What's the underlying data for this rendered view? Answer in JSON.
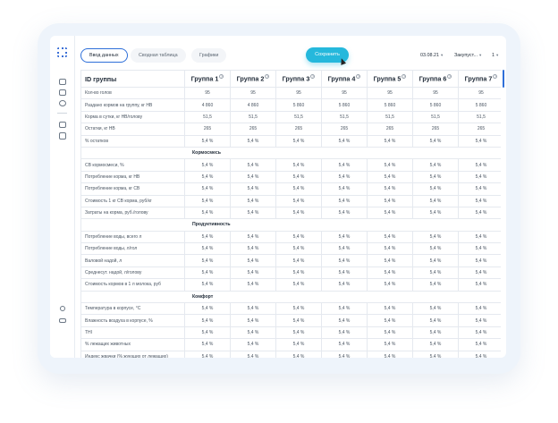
{
  "toolbar": {
    "tabs": [
      "Ввод данных",
      "Сводная таблица",
      "Графики"
    ],
    "save_label": "Сохранить",
    "date": "03.08.21",
    "filter": "Закупуст...",
    "page": "1"
  },
  "table": {
    "first_header": "ID группы",
    "groups": [
      "Группа 1",
      "Группа 2",
      "Группа 3",
      "Группа 4",
      "Группа 5",
      "Группа 6",
      "Группа 7"
    ],
    "info_mark": "?",
    "rows": [
      {
        "label": "Кол-во голов",
        "values": [
          "95",
          "95",
          "95",
          "95",
          "95",
          "95",
          "95"
        ]
      },
      {
        "label": "Раздано кормов на группу, кг НВ",
        "values": [
          "4 860",
          "4 860",
          "5 860",
          "5 860",
          "5 860",
          "5 860",
          "5 860"
        ]
      },
      {
        "label": "Корма в сутки, кг НВ/голову",
        "values": [
          "51,5",
          "51,5",
          "51,5",
          "51,5",
          "51,5",
          "51,5",
          "51,5"
        ]
      },
      {
        "label": "Остатки, кг НВ",
        "values": [
          "265",
          "265",
          "265",
          "265",
          "265",
          "265",
          "265"
        ]
      },
      {
        "label": "% остатков",
        "values": [
          "5,4 %",
          "5,4 %",
          "5,4 %",
          "5,4 %",
          "5,4 %",
          "5,4 %",
          "5,4 %"
        ]
      },
      {
        "section": "Кормосмесь"
      },
      {
        "label": "СВ кормосмеси, %",
        "values": [
          "5,4 %",
          "5,4 %",
          "5,4 %",
          "5,4 %",
          "5,4 %",
          "5,4 %",
          "5,4 %"
        ]
      },
      {
        "label": "Потребление корма, кг НВ",
        "values": [
          "5,4 %",
          "5,4 %",
          "5,4 %",
          "5,4 %",
          "5,4 %",
          "5,4 %",
          "5,4 %"
        ]
      },
      {
        "label": "Потребление корма, кг СВ",
        "values": [
          "5,4 %",
          "5,4 %",
          "5,4 %",
          "5,4 %",
          "5,4 %",
          "5,4 %",
          "5,4 %"
        ]
      },
      {
        "label": "Стоимость 1 кг СВ корма, руб/кг",
        "values": [
          "5,4 %",
          "5,4 %",
          "5,4 %",
          "5,4 %",
          "5,4 %",
          "5,4 %",
          "5,4 %"
        ]
      },
      {
        "label": "Затраты на корма, руб./голову",
        "values": [
          "5,4 %",
          "5,4 %",
          "5,4 %",
          "5,4 %",
          "5,4 %",
          "5,4 %",
          "5,4 %"
        ]
      },
      {
        "section": "Продуктивность"
      },
      {
        "label": "Потребление воды, всего л",
        "values": [
          "5,4 %",
          "5,4 %",
          "5,4 %",
          "5,4 %",
          "5,4 %",
          "5,4 %",
          "5,4 %"
        ]
      },
      {
        "label": "Потребление воды, л/гол",
        "values": [
          "5,4 %",
          "5,4 %",
          "5,4 %",
          "5,4 %",
          "5,4 %",
          "5,4 %",
          "5,4 %"
        ]
      },
      {
        "label": "Валовой надой, л",
        "values": [
          "5,4 %",
          "5,4 %",
          "5,4 %",
          "5,4 %",
          "5,4 %",
          "5,4 %",
          "5,4 %"
        ]
      },
      {
        "label": "Среднесут. надой, л/голову",
        "values": [
          "5,4 %",
          "5,4 %",
          "5,4 %",
          "5,4 %",
          "5,4 %",
          "5,4 %",
          "5,4 %"
        ]
      },
      {
        "label": "Стоимость кормов в 1 л молока, руб",
        "values": [
          "5,4 %",
          "5,4 %",
          "5,4 %",
          "5,4 %",
          "5,4 %",
          "5,4 %",
          "5,4 %"
        ]
      },
      {
        "section": "Комфорт"
      },
      {
        "label": "Температура в корпусе, °С",
        "values": [
          "5,4 %",
          "5,4 %",
          "5,4 %",
          "5,4 %",
          "5,4 %",
          "5,4 %",
          "5,4 %"
        ]
      },
      {
        "label": "Влажность воздуха в корпусе, %",
        "values": [
          "5,4 %",
          "5,4 %",
          "5,4 %",
          "5,4 %",
          "5,4 %",
          "5,4 %",
          "5,4 %"
        ]
      },
      {
        "label": "THI",
        "values": [
          "5,4 %",
          "5,4 %",
          "5,4 %",
          "5,4 %",
          "5,4 %",
          "5,4 %",
          "5,4 %"
        ]
      },
      {
        "label": "% лежащих животных",
        "values": [
          "5,4 %",
          "5,4 %",
          "5,4 %",
          "5,4 %",
          "5,4 %",
          "5,4 %",
          "5,4 %"
        ]
      },
      {
        "label": "Индекс жвачки (% жующих от лежащих)",
        "values": [
          "5,4 %",
          "5,4 %",
          "5,4 %",
          "5,4 %",
          "5,4 %",
          "5,4 %",
          "5,4 %"
        ]
      }
    ]
  }
}
